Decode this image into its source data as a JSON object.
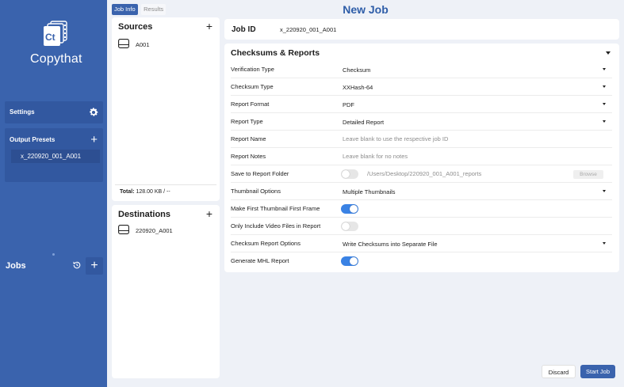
{
  "app": {
    "name": "Copythat",
    "logo_mark": "Ct"
  },
  "sidebar": {
    "settings_label": "Settings",
    "output_presets_label": "Output Presets",
    "presets": [
      "x_220920_001_A001"
    ],
    "jobs_label": "Jobs",
    "add_symbol": "+"
  },
  "tabs": [
    {
      "label": "Job Info",
      "active": true
    },
    {
      "label": "Results",
      "active": false
    }
  ],
  "sources": {
    "title": "Sources",
    "items": [
      "A001"
    ],
    "total_label": "Total:",
    "total_value": "128.00 KB / --"
  },
  "destinations": {
    "title": "Destinations",
    "items": [
      "220920_A001"
    ]
  },
  "header": {
    "title": "New Job"
  },
  "job": {
    "id_label": "Job ID",
    "id_value": "x_220920_001_A001"
  },
  "reports": {
    "title": "Checksums & Reports",
    "verification_type": {
      "label": "Verification Type",
      "value": "Checksum"
    },
    "checksum_type": {
      "label": "Checksum Type",
      "value": "XXHash-64"
    },
    "report_format": {
      "label": "Report Format",
      "value": "PDF"
    },
    "report_type": {
      "label": "Report Type",
      "value": "Detailed Report"
    },
    "report_name": {
      "label": "Report Name",
      "placeholder": "Leave blank to use the respective job ID"
    },
    "report_notes": {
      "label": "Report Notes",
      "placeholder": "Leave blank for no notes"
    },
    "save_to_folder": {
      "label": "Save to Report Folder",
      "enabled": false,
      "path": "/Users/Desktop/220920_001_A001_reports",
      "browse_label": "Browse"
    },
    "thumbnail_options": {
      "label": "Thumbnail Options",
      "value": "Multiple Thumbnails"
    },
    "first_frame": {
      "label": "Make First Thumbnail First Frame",
      "enabled": true
    },
    "only_video": {
      "label": "Only Include Video Files in Report",
      "enabled": false
    },
    "checksum_report_options": {
      "label": "Checksum Report Options",
      "value": "Write Checksums into Separate File"
    },
    "generate_mhl": {
      "label": "Generate MHL Report",
      "enabled": true
    }
  },
  "actions": {
    "discard_label": "Discard",
    "start_label": "Start Job"
  },
  "colors": {
    "sidebar": "#3a63ad",
    "accent": "#2e5da8",
    "toggle_on": "#3a82e4"
  }
}
